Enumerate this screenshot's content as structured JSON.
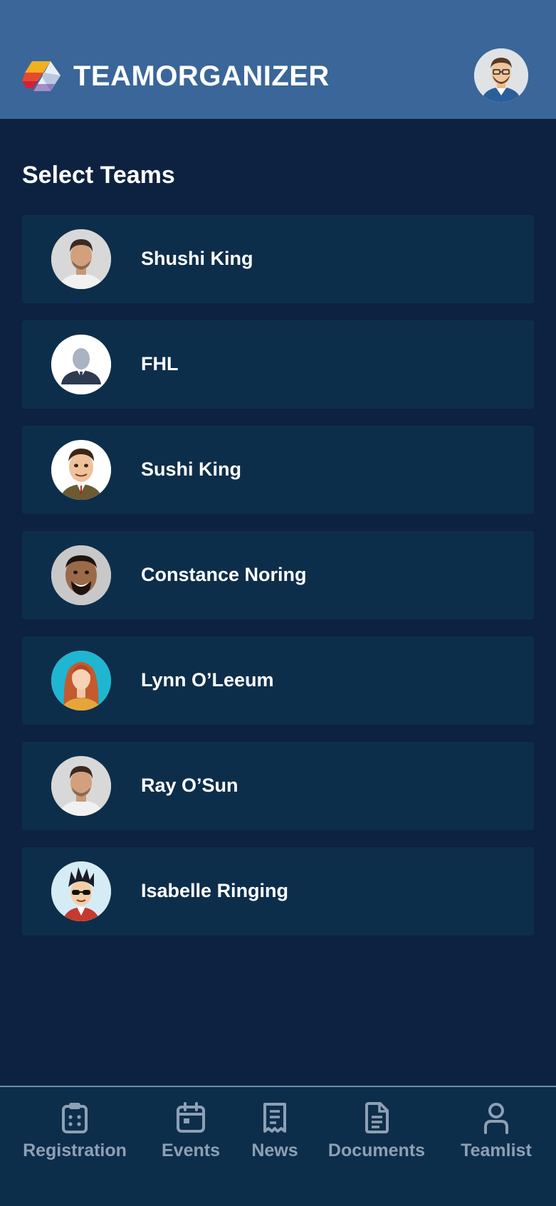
{
  "header": {
    "app_name": "TEAMORGANIZER",
    "logo_icon": "teamorganizer-logo",
    "profile_avatar_icon": "user-avatar-icon"
  },
  "main": {
    "section_title": "Select Teams",
    "teams": [
      {
        "name": "Shushi King",
        "avatar": "man-photo-avatar"
      },
      {
        "name": "FHL",
        "avatar": "default-person-avatar"
      },
      {
        "name": "Sushi King",
        "avatar": "cartoon-man-avatar"
      },
      {
        "name": "Constance Noring",
        "avatar": "cartoon-smiling-man-avatar"
      },
      {
        "name": "Lynn O’Leeum",
        "avatar": "woman-photo-avatar"
      },
      {
        "name": "Ray O’Sun",
        "avatar": "man-photo-avatar"
      },
      {
        "name": "Isabelle Ringing",
        "avatar": "cartoon-sunglasses-avatar"
      }
    ]
  },
  "bottom_nav": {
    "items": [
      {
        "label": "Registration",
        "icon": "clipboard-icon"
      },
      {
        "label": "Events",
        "icon": "calendar-icon"
      },
      {
        "label": "News",
        "icon": "receipt-icon"
      },
      {
        "label": "Documents",
        "icon": "document-icon"
      },
      {
        "label": "Teamlist",
        "icon": "person-icon"
      }
    ]
  },
  "colors": {
    "header_bg": "#3a6699",
    "page_bg": "#0c2240",
    "card_bg": "#0d2e4a",
    "nav_text": "#8ea0b4"
  }
}
